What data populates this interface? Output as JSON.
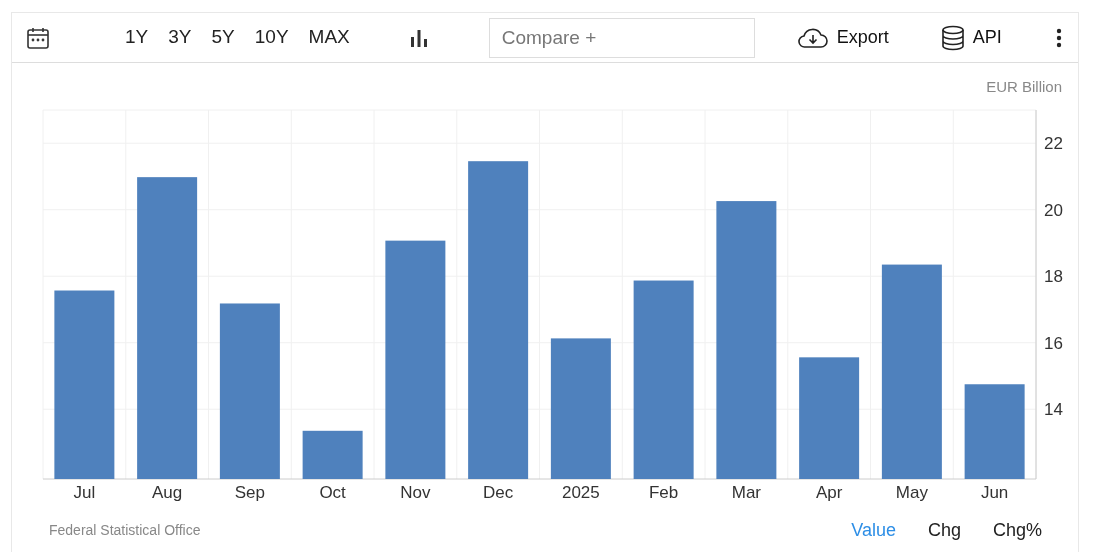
{
  "toolbar": {
    "ranges": [
      "1Y",
      "3Y",
      "5Y",
      "10Y",
      "MAX"
    ],
    "compare": {
      "placeholder": "Compare +"
    },
    "export": "Export",
    "api": "API"
  },
  "unit": "EUR Billion",
  "chart": {
    "chart_data": {
      "type": "bar",
      "categories": [
        "Jul",
        "Aug",
        "Sep",
        "Oct",
        "Nov",
        "Dec",
        "2025",
        "Feb",
        "Mar",
        "Apr",
        "May",
        "Jun"
      ],
      "grid": true,
      "series": [
        {
          "color": "#4f81bd",
          "values": [
            17.57,
            20.98,
            17.18,
            13.35,
            19.07,
            21.46,
            16.13,
            17.87,
            20.26,
            15.56,
            18.35,
            14.75
          ]
        }
      ],
      "ylim": [
        11.9,
        23
      ],
      "yticks": [
        14,
        16,
        18,
        20,
        22
      ]
    }
  },
  "source": "Federal Statistical Office",
  "views": [
    {
      "label": "Value",
      "selected": true
    },
    {
      "label": "Chg",
      "selected": false
    },
    {
      "label": "Chg%",
      "selected": false
    }
  ]
}
